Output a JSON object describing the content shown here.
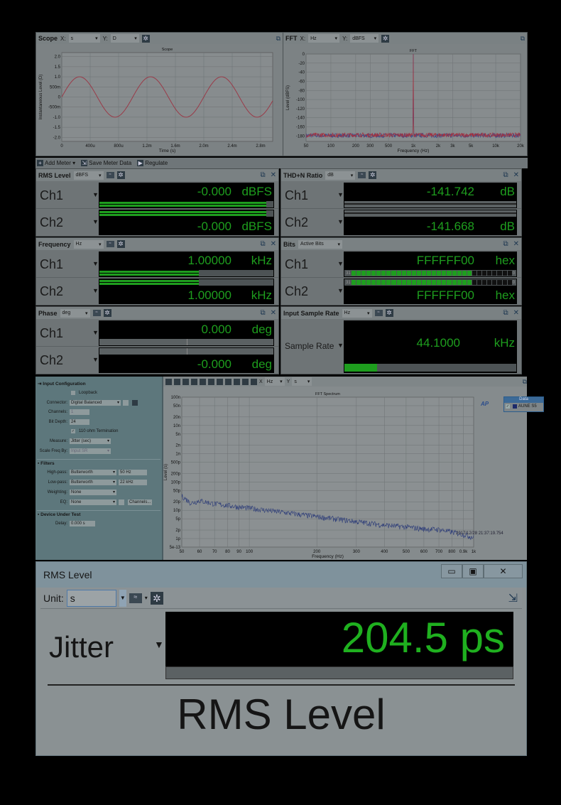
{
  "scope": {
    "title": "Scope",
    "x_prefix": "X:",
    "x_unit": "s",
    "y_prefix": "Y:",
    "y_unit": "D"
  },
  "fft": {
    "title": "FFT",
    "x_prefix": "X:",
    "x_unit": "Hz",
    "y_prefix": "Y:",
    "y_unit": "dBFS"
  },
  "toolbar": {
    "add_meter": "Add Meter",
    "save_meter_data": "Save Meter Data",
    "regulate": "Regulate"
  },
  "meters": [
    {
      "title": "RMS Level",
      "unit_select": "dBFS",
      "rows": [
        {
          "label": "Ch1",
          "value": "-0.000",
          "unit": "dBFS",
          "bar": "double",
          "level": 0.96
        },
        {
          "label": "Ch2",
          "value": "-0.000",
          "unit": "dBFS",
          "bar": "double",
          "level": 0.96
        }
      ]
    },
    {
      "title": "THD+N Ratio",
      "unit_select": "dB",
      "rows": [
        {
          "label": "Ch1",
          "value": "-141.742",
          "unit": "dB",
          "bar": "thd",
          "level": 0
        },
        {
          "label": "Ch2",
          "value": "-141.668",
          "unit": "dB",
          "bar": "thd",
          "level": 0
        }
      ]
    },
    {
      "title": "Frequency",
      "unit_select": "Hz",
      "rows": [
        {
          "label": "Ch1",
          "value": "1.00000",
          "unit": "kHz",
          "bar": "double",
          "level": 0.57
        },
        {
          "label": "Ch2",
          "value": "1.00000",
          "unit": "kHz",
          "bar": "double",
          "level": 0.57
        }
      ]
    },
    {
      "title": "Bits",
      "unit_select": "Active Bits",
      "no_icons": true,
      "rows": [
        {
          "label": "Ch1",
          "value": "FFFFFF00",
          "unit": "hex",
          "bar": "bits",
          "bits_hi": "31",
          "bits_lo": "0",
          "active_bits": 24,
          "total_bits": 32
        },
        {
          "label": "Ch2",
          "value": "FFFFFF00",
          "unit": "hex",
          "bar": "bits",
          "bits_hi": "31",
          "bits_lo": "0",
          "active_bits": 24,
          "total_bits": 32
        }
      ]
    },
    {
      "title": "Phase",
      "unit_select": "deg",
      "rows": [
        {
          "label": "Ch1",
          "value": "0.000",
          "unit": "deg",
          "bar": "phase",
          "level": 0
        },
        {
          "label": "Ch2",
          "value": "-0.000",
          "unit": "deg",
          "bar": "phase",
          "level": 0
        }
      ]
    },
    {
      "title": "Input Sample Rate",
      "unit_select": "Hz",
      "single": true,
      "rows": [
        {
          "label": "Sample Rate",
          "value": "44.1000",
          "unit": "kHz",
          "bar": "single",
          "level": 0.19
        }
      ]
    }
  ],
  "config": {
    "input_title": "Input Configuration",
    "loopback": "Loopback",
    "connector_label": "Connector:",
    "connector": "Digital Balanced",
    "channels_label": "Channels:",
    "channels": "1",
    "bit_depth_label": "Bit Depth:",
    "bit_depth": "24",
    "termination": "110 ohm Termination",
    "measure_label": "Measure:",
    "measure": "Jitter (sec)",
    "scale_label": "Scale Freq By:",
    "scale": "Input SR",
    "filters_title": "Filters",
    "highpass_label": "High-pass:",
    "highpass": "Butterworth",
    "highpass_freq": "50 Hz",
    "lowpass_label": "Low-pass:",
    "lowpass": "Butterworth",
    "lowpass_freq": "22 kHz",
    "weighting_label": "Weighting:",
    "weighting": "None",
    "eq_label": "EQ:",
    "eq": "None",
    "channels_button": "Channels...",
    "dut_title": "Device Under Test",
    "delay_label": "Delay:",
    "delay": "0.000 s"
  },
  "spectrum": {
    "x_prefix": "X",
    "x_unit": "Hz",
    "y_prefix": "Y",
    "y_unit": "s",
    "timestamp": "2017/12/28 21:37:19.754",
    "legend_title": "Data",
    "legend_item": "AUNE S5",
    "logo": "AP"
  },
  "window": {
    "title": "RMS Level",
    "unit_label": "Unit:",
    "unit": "s",
    "channel": "Jitter",
    "value": "204.5",
    "value_unit": "ps",
    "caption": "RMS Level",
    "level": 1.0
  },
  "chart_data": [
    {
      "type": "line",
      "title": "Scope",
      "xlabel": "Time (s)",
      "ylabel": "Instantaneous Level (D)",
      "xlim": [
        0,
        0.00297
      ],
      "ylim": [
        -2.2,
        2.2
      ],
      "x_ticks": [
        {
          "v": 0,
          "label": "0"
        },
        {
          "v": 0.0004,
          "label": "400u"
        },
        {
          "v": 0.0008,
          "label": "800u"
        },
        {
          "v": 0.0012,
          "label": "1.2m"
        },
        {
          "v": 0.0016,
          "label": "1.6m"
        },
        {
          "v": 0.002,
          "label": "2.0m"
        },
        {
          "v": 0.0024,
          "label": "2.4m"
        },
        {
          "v": 0.0028,
          "label": "2.8m"
        }
      ],
      "y_ticks": [
        {
          "v": 2,
          "label": "2.0"
        },
        {
          "v": 1.5,
          "label": "1.5"
        },
        {
          "v": 1,
          "label": "1.0"
        },
        {
          "v": 0.5,
          "label": "500m"
        },
        {
          "v": 0,
          "label": "0"
        },
        {
          "v": -0.5,
          "label": "-500m"
        },
        {
          "v": -1,
          "label": "-1.0"
        },
        {
          "v": -1.5,
          "label": "-1.5"
        },
        {
          "v": -2,
          "label": "-2.0"
        }
      ],
      "series": [
        {
          "name": "Ch1",
          "function": "sine",
          "frequency_hz": 1000,
          "amplitude": 1.0,
          "color": "#9a3a48"
        }
      ],
      "grid": true
    },
    {
      "type": "line",
      "title": "FFT",
      "xlabel": "Frequency (Hz)",
      "ylabel": "Level (dBFS)",
      "xscale": "log",
      "xlim": [
        50,
        20000
      ],
      "ylim": [
        -192,
        0
      ],
      "x_ticks": [
        {
          "v": 50,
          "label": "50"
        },
        {
          "v": 100,
          "label": "100"
        },
        {
          "v": 200,
          "label": "200"
        },
        {
          "v": 300,
          "label": "300"
        },
        {
          "v": 500,
          "label": "500"
        },
        {
          "v": 1000,
          "label": "1k"
        },
        {
          "v": 2000,
          "label": "2k"
        },
        {
          "v": 3000,
          "label": "3k"
        },
        {
          "v": 5000,
          "label": "5k"
        },
        {
          "v": 10000,
          "label": "10k"
        },
        {
          "v": 20000,
          "label": "20k"
        }
      ],
      "y_ticks": [
        {
          "v": 0,
          "label": "0"
        },
        {
          "v": -20,
          "label": "-20"
        },
        {
          "v": -40,
          "label": "-40"
        },
        {
          "v": -60,
          "label": "-60"
        },
        {
          "v": -80,
          "label": "-80"
        },
        {
          "v": -100,
          "label": "-100"
        },
        {
          "v": -120,
          "label": "-120"
        },
        {
          "v": -140,
          "label": "-140"
        },
        {
          "v": -160,
          "label": "-160"
        },
        {
          "v": -180,
          "label": "-180"
        }
      ],
      "series": [
        {
          "name": "Ch2",
          "color": "#34468a",
          "peak_hz": 1000,
          "peak_db": 0,
          "noise_floor_db": -181
        },
        {
          "name": "Ch1",
          "color": "#a5303e",
          "peak_hz": 1000,
          "peak_db": 0,
          "noise_floor_db": -180
        }
      ],
      "grid": true
    },
    {
      "type": "line",
      "title": "FFT Spectrum",
      "xlabel": "Frequency (Hz)",
      "ylabel": "Level (s)",
      "xscale": "log",
      "yscale": "log",
      "xlim": [
        50,
        1000
      ],
      "ylim": [
        5e-13,
        1e-07
      ],
      "x_ticks": [
        {
          "v": 50,
          "label": "50"
        },
        {
          "v": 60,
          "label": "60"
        },
        {
          "v": 70,
          "label": "70"
        },
        {
          "v": 80,
          "label": "80"
        },
        {
          "v": 90,
          "label": "90"
        },
        {
          "v": 100,
          "label": "100"
        },
        {
          "v": 200,
          "label": "200"
        },
        {
          "v": 300,
          "label": "300"
        },
        {
          "v": 400,
          "label": "400"
        },
        {
          "v": 500,
          "label": "500"
        },
        {
          "v": 600,
          "label": "600"
        },
        {
          "v": 700,
          "label": "700"
        },
        {
          "v": 800,
          "label": "800"
        },
        {
          "v": 900,
          "label": "0.9k"
        },
        {
          "v": 1000,
          "label": "1k"
        }
      ],
      "y_ticks": [
        {
          "v": 1e-07,
          "label": "100n"
        },
        {
          "v": 5e-08,
          "label": "50n"
        },
        {
          "v": 2e-08,
          "label": "20n"
        },
        {
          "v": 1e-08,
          "label": "10n"
        },
        {
          "v": 5e-09,
          "label": "5n"
        },
        {
          "v": 2e-09,
          "label": "2n"
        },
        {
          "v": 1e-09,
          "label": "1n"
        },
        {
          "v": 5e-10,
          "label": "500p"
        },
        {
          "v": 2e-10,
          "label": "200p"
        },
        {
          "v": 1e-10,
          "label": "100p"
        },
        {
          "v": 5e-11,
          "label": "50p"
        },
        {
          "v": 2e-11,
          "label": "20p"
        },
        {
          "v": 1e-11,
          "label": "10p"
        },
        {
          "v": 5e-12,
          "label": "5p"
        },
        {
          "v": 2e-12,
          "label": "2p"
        },
        {
          "v": 1e-12,
          "label": "1p"
        },
        {
          "v": 5e-13,
          "label": "5e-13"
        }
      ],
      "series": [
        {
          "name": "AUNE S5",
          "color": "#2a3a78",
          "x": [
            50,
            55,
            60,
            70,
            80,
            90,
            100,
            150,
            200,
            300,
            400,
            500,
            600,
            700,
            800,
            900,
            1000
          ],
          "y": [
            3.2e-11,
            1.8e-11,
            2.2e-11,
            1.7e-11,
            1.5e-11,
            1.3e-11,
            1.2e-11,
            8e-12,
            6e-12,
            4e-12,
            3e-12,
            2.6e-12,
            2.2e-12,
            2.1e-12,
            1.7e-12,
            1.4e-12,
            1.1e-12
          ]
        }
      ],
      "grid": true
    }
  ]
}
